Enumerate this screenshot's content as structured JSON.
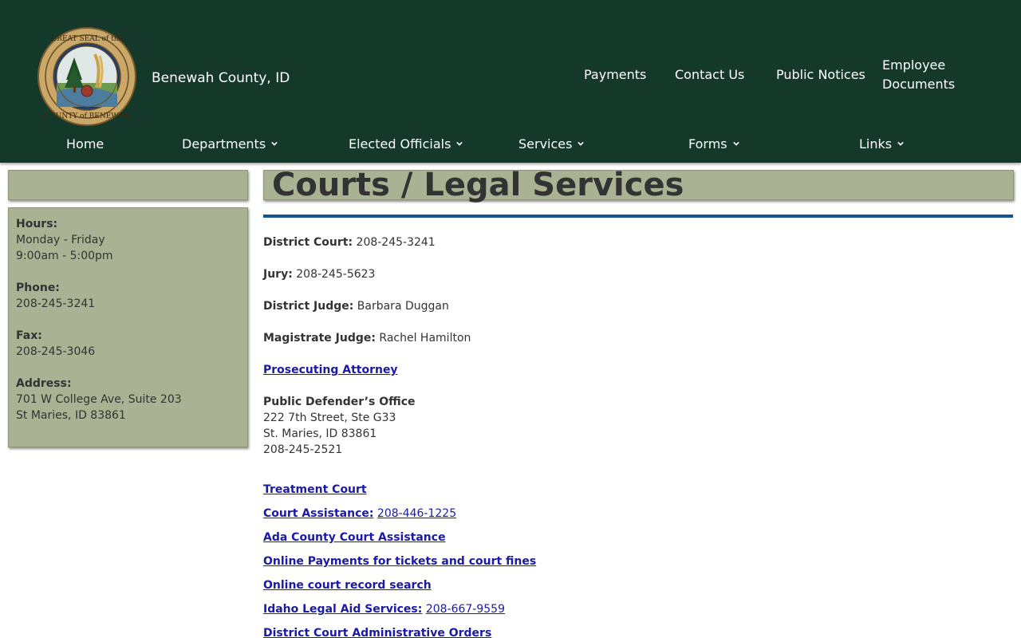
{
  "site": {
    "name": "Benewah County, ID",
    "seal_alt": "GREAT SEAL of the COUNTY of BENEWAH"
  },
  "utility_nav": {
    "payments": "Payments",
    "contact": "Contact Us",
    "notices": "Public Notices",
    "employee_line1": "Employee",
    "employee_line2": "Documents"
  },
  "main_nav": {
    "home": "Home",
    "departments": "Departments",
    "elected": "Elected Officials",
    "services": "Services",
    "forms": "Forms",
    "links": "Links"
  },
  "sidebar": {
    "hours_label": "Hours:",
    "hours_days": "Monday - Friday",
    "hours_time": "9:00am - 5:00pm",
    "phone_label": "Phone:",
    "phone": "208-245-3241",
    "fax_label": "Fax:",
    "fax": "208-245-3046",
    "address_label": "Address:",
    "address_line1": "701 W College Ave, Suite 203",
    "address_line2": "St Maries, ID 83861"
  },
  "page": {
    "title": "Courts / Legal Services"
  },
  "content": {
    "district_court_label": "District Court:",
    "district_court_phone": "208-245-3241",
    "jury_label": "Jury:",
    "jury_phone": "208-245-5623",
    "district_judge_label": "District Judge:",
    "district_judge": "Barbara Duggan",
    "magistrate_label": "Magistrate Judge:",
    "magistrate": "Rachel Hamilton",
    "prosecuting": "Prosecuting Attorney",
    "public_defender_label": "Public Defender’s Office",
    "pd_line1": "222 7th Street, Ste G33",
    "pd_line2": "St. Maries, ID 83861",
    "pd_phone": "208-245-2521",
    "treatment_court": "Treatment Court",
    "court_assistance_label": "Court Assistance:",
    "court_assistance_phone": "208-446-1225",
    "ada_county": "Ada County Court Assistance",
    "online_payments": "Online Payments for tickets and court fines",
    "record_search": "Online court record search",
    "legal_aid_label": "Idaho Legal Aid Services:",
    "legal_aid_phone": "208-667-9559",
    "admin_orders": "District Court Administrative Orders"
  }
}
